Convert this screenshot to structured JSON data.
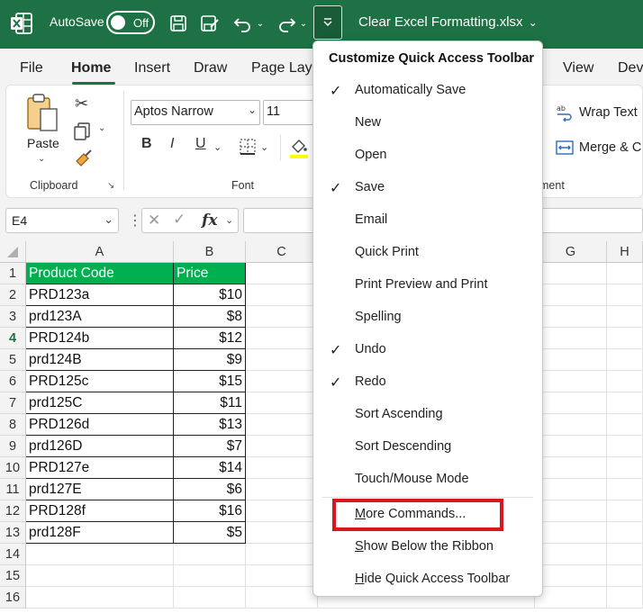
{
  "titlebar": {
    "autosave_label": "AutoSave",
    "autosave_state": "Off",
    "document_title": "Clear Excel Formatting.xlsx",
    "colors": {
      "bar": "#1e7145"
    }
  },
  "tabs": {
    "file": "File",
    "home": "Home",
    "insert": "Insert",
    "draw": "Draw",
    "page_layout": "Page Lay",
    "view": "View",
    "developer": "Dev"
  },
  "ribbon": {
    "paste_label": "Paste",
    "clipboard_label": "Clipboard",
    "font_name": "Aptos Narrow",
    "font_size": "11",
    "font_label": "Font",
    "bold": "B",
    "italic": "I",
    "underline": "U",
    "wrap_text": "Wrap Text",
    "merge_center": "Merge & C",
    "alignment_label_fragment": "ment"
  },
  "formula_bar": {
    "name_box": "E4",
    "fx": "fx"
  },
  "grid": {
    "columns": [
      "A",
      "B",
      "C",
      "G",
      "H"
    ],
    "header_row": {
      "a": "Product Code",
      "b": "Price"
    },
    "row_numbers": [
      "1",
      "2",
      "3",
      "4",
      "5",
      "6",
      "7",
      "8",
      "9",
      "10",
      "11",
      "12",
      "13",
      "14",
      "15",
      "16"
    ],
    "rows": [
      {
        "a": "PRD123a",
        "b": "$10"
      },
      {
        "a": "prd123A",
        "b": "$8"
      },
      {
        "a": "PRD124b",
        "b": "$12"
      },
      {
        "a": "prd124B",
        "b": "$9"
      },
      {
        "a": "PRD125c",
        "b": "$15"
      },
      {
        "a": "prd125C",
        "b": "$11"
      },
      {
        "a": "PRD126d",
        "b": "$13"
      },
      {
        "a": "prd126D",
        "b": "$7"
      },
      {
        "a": "PRD127e",
        "b": "$14"
      },
      {
        "a": "prd127E",
        "b": "$6"
      },
      {
        "a": "PRD128f",
        "b": "$16"
      },
      {
        "a": "prd128F",
        "b": "$5"
      }
    ]
  },
  "menu": {
    "title": "Customize Quick Access Toolbar",
    "items": [
      {
        "label": "Automatically Save",
        "checked": "✓"
      },
      {
        "label": "New",
        "checked": ""
      },
      {
        "label": "Open",
        "checked": ""
      },
      {
        "label": "Save",
        "checked": "✓"
      },
      {
        "label": "Email",
        "checked": ""
      },
      {
        "label": "Quick Print",
        "checked": ""
      },
      {
        "label": "Print Preview and Print",
        "checked": ""
      },
      {
        "label": "Spelling",
        "checked": ""
      },
      {
        "label": "Undo",
        "checked": "✓"
      },
      {
        "label": "Redo",
        "checked": "✓"
      },
      {
        "label": "Sort Ascending",
        "checked": ""
      },
      {
        "label": "Sort Descending",
        "checked": ""
      },
      {
        "label": "Touch/Mouse Mode",
        "checked": ""
      }
    ],
    "more_commands": {
      "first": "M",
      "rest": "ore Commands..."
    },
    "show_below": {
      "first": "S",
      "rest": "how Below the Ribbon"
    },
    "hide_toolbar": {
      "first": "H",
      "rest": "ide Quick Access Toolbar"
    }
  },
  "colors": {
    "header_fill": "#00b050",
    "highlight_box": "#d9151e",
    "accent": "#1e7145"
  }
}
